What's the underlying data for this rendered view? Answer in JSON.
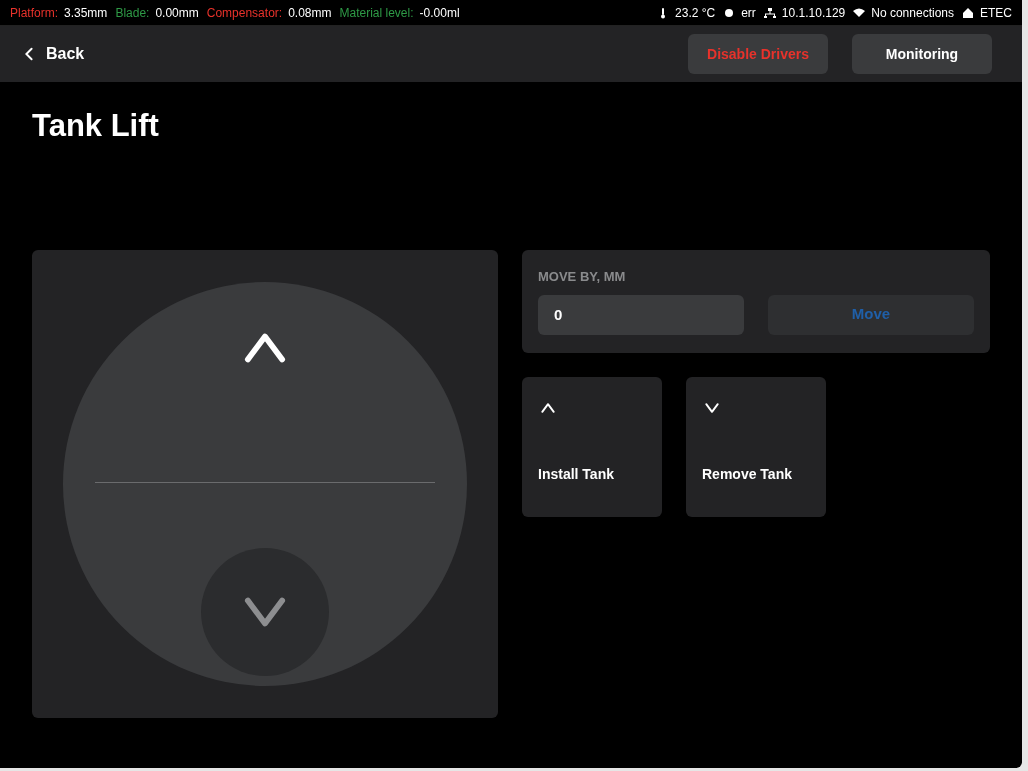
{
  "status_bar": {
    "readings": [
      {
        "label": "Platform:",
        "value": "3.35mm",
        "color": "#e8322b"
      },
      {
        "label": "Blade:",
        "value": "0.00mm",
        "color": "#2e9a46"
      },
      {
        "label": "Compensator:",
        "value": "0.08mm",
        "color": "#e8322b"
      },
      {
        "label": "Material level:",
        "value": "-0.00ml",
        "color": "#2e9a46"
      }
    ],
    "indicators": [
      {
        "kind": "temperature",
        "text": "23.2 °C"
      },
      {
        "kind": "status",
        "text": "err"
      },
      {
        "kind": "network",
        "text": "10.1.10.129"
      },
      {
        "kind": "wifi",
        "text": "No connections"
      },
      {
        "kind": "home",
        "text": "ETEC"
      }
    ]
  },
  "header": {
    "back": "Back",
    "buttons": [
      {
        "label": "Disable Drivers",
        "kind": "danger"
      },
      {
        "label": "Monitoring",
        "kind": "normal"
      }
    ]
  },
  "title": "Tank Lift",
  "joystick": {
    "up": {
      "selected": false
    },
    "down": {
      "selected": true
    }
  },
  "move": {
    "label": "MOVE BY, MM",
    "value": "0",
    "button": "Move"
  },
  "actions": [
    {
      "label": "Install Tank",
      "kind": "up"
    },
    {
      "label": "Remove Tank",
      "kind": "down"
    }
  ]
}
